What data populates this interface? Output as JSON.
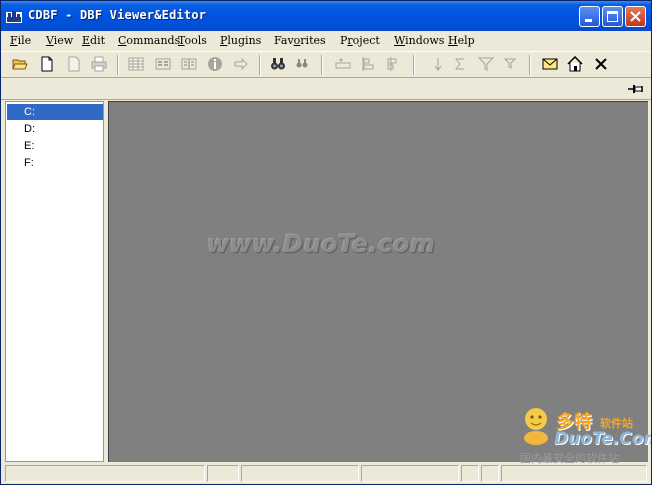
{
  "window": {
    "title": "CDBF - DBF Viewer&Editor"
  },
  "menu": [
    {
      "key": "F",
      "rest": "ile"
    },
    {
      "key": "V",
      "rest": "iew"
    },
    {
      "key": "E",
      "rest": "dit"
    },
    {
      "key": "C",
      "rest": "ommands"
    },
    {
      "key": "T",
      "rest": "ools"
    },
    {
      "key": "P",
      "rest": "lugins"
    },
    {
      "pre": "Fav",
      "key": "o",
      "rest": "rites"
    },
    {
      "pre": "P",
      "key": "r",
      "rest": "oject"
    },
    {
      "key": "W",
      "rest": "indows"
    },
    {
      "key": "H",
      "rest": "elp"
    }
  ],
  "toolbar_icons": [
    "open-folder-icon",
    "new-file-icon",
    "blank-page-icon",
    "print-icon",
    "table-grid-icon",
    "form-view-icon",
    "columns-view-icon",
    "info-icon",
    "go-arrow-icon",
    "find-icon",
    "find-next-icon",
    "insert-record-icon",
    "align-left-icon",
    "align-right-icon",
    "sort-down-icon",
    "sum-icon",
    "filter-icon",
    "filter-clear-icon",
    "mail-icon",
    "home-icon",
    "close-icon"
  ],
  "drives": [
    {
      "label": "C:",
      "selected": true
    },
    {
      "label": "D:",
      "selected": false
    },
    {
      "label": "E:",
      "selected": false
    },
    {
      "label": "F:",
      "selected": false
    }
  ],
  "watermark": "www.DuoTe.com",
  "logo": {
    "cn_big": "多特",
    "cn_small": "软件站",
    "en": "DuoTe.Com",
    "slogan": "国内最安全的软件站"
  },
  "colors": {
    "title_bar": "#0054E3",
    "selection": "#316AC5",
    "workspace": "#808080"
  }
}
